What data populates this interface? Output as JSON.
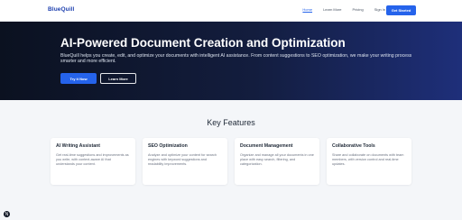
{
  "header": {
    "logo": "BlueQuill",
    "nav": [
      {
        "label": "Home",
        "active": true
      },
      {
        "label": "Learn More",
        "active": false
      },
      {
        "label": "Pricing",
        "active": false
      },
      {
        "label": "Sign in",
        "active": false
      }
    ],
    "cta_label": "Get Started"
  },
  "hero": {
    "title": "AI-Powered Document Creation and Optimization",
    "description": "BlueQuill helps you create, edit, and optimize your documents with intelligent AI assistance. From content suggestions to SEO optimization, we make your writing process smarter and more efficient.",
    "primary_button": "Try it Now",
    "secondary_button": "Learn More"
  },
  "features": {
    "title": "Key Features",
    "cards": [
      {
        "title": "AI Writing Assistant",
        "description": "Get real-time suggestions and improvements as you write, with context-aware AI that understands your content."
      },
      {
        "title": "SEO Optimization",
        "description": "Analyze and optimize your content for search engines with keyword suggestions and readability improvements."
      },
      {
        "title": "Document Management",
        "description": "Organize and manage all your documents in one place with easy search, filtering, and categorization."
      },
      {
        "title": "Collaborative Tools",
        "description": "Share and collaborate on documents with team members, with version control and real-time updates."
      }
    ]
  },
  "colors": {
    "accent": "#2563eb",
    "hero_dark": "#0b1120",
    "hero_light": "#1e2f7a"
  }
}
